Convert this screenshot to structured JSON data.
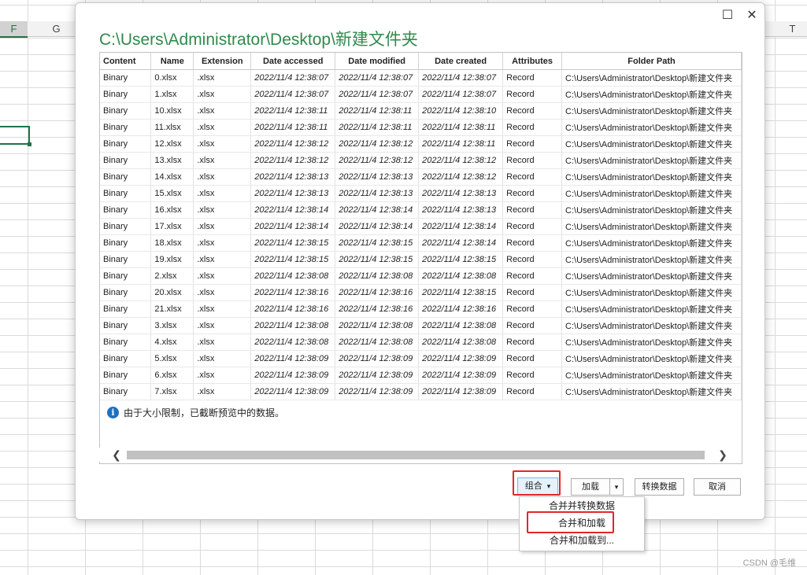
{
  "spreadsheet": {
    "col_headers": [
      {
        "label": "F",
        "selected": true
      },
      {
        "label": "G",
        "selected": false
      },
      {
        "label": "T",
        "selected": false
      }
    ],
    "watermark": "CSDN @毛维"
  },
  "dialog": {
    "title": "C:\\Users\\Administrator\\Desktop\\新建文件夹",
    "window_buttons": {
      "maximize": "☐",
      "close": "✕"
    },
    "table": {
      "columns": [
        "Content",
        "Name",
        "Extension",
        "Date accessed",
        "Date modified",
        "Date created",
        "Attributes",
        "Folder Path"
      ],
      "rows": [
        [
          "Binary",
          "0.xlsx",
          ".xlsx",
          "2022/11/4 12:38:07",
          "2022/11/4 12:38:07",
          "2022/11/4 12:38:07",
          "Record",
          "C:\\Users\\Administrator\\Desktop\\新建文件夹"
        ],
        [
          "Binary",
          "1.xlsx",
          ".xlsx",
          "2022/11/4 12:38:07",
          "2022/11/4 12:38:07",
          "2022/11/4 12:38:07",
          "Record",
          "C:\\Users\\Administrator\\Desktop\\新建文件夹"
        ],
        [
          "Binary",
          "10.xlsx",
          ".xlsx",
          "2022/11/4 12:38:11",
          "2022/11/4 12:38:11",
          "2022/11/4 12:38:10",
          "Record",
          "C:\\Users\\Administrator\\Desktop\\新建文件夹"
        ],
        [
          "Binary",
          "11.xlsx",
          ".xlsx",
          "2022/11/4 12:38:11",
          "2022/11/4 12:38:11",
          "2022/11/4 12:38:11",
          "Record",
          "C:\\Users\\Administrator\\Desktop\\新建文件夹"
        ],
        [
          "Binary",
          "12.xlsx",
          ".xlsx",
          "2022/11/4 12:38:12",
          "2022/11/4 12:38:12",
          "2022/11/4 12:38:11",
          "Record",
          "C:\\Users\\Administrator\\Desktop\\新建文件夹"
        ],
        [
          "Binary",
          "13.xlsx",
          ".xlsx",
          "2022/11/4 12:38:12",
          "2022/11/4 12:38:12",
          "2022/11/4 12:38:12",
          "Record",
          "C:\\Users\\Administrator\\Desktop\\新建文件夹"
        ],
        [
          "Binary",
          "14.xlsx",
          ".xlsx",
          "2022/11/4 12:38:13",
          "2022/11/4 12:38:13",
          "2022/11/4 12:38:12",
          "Record",
          "C:\\Users\\Administrator\\Desktop\\新建文件夹"
        ],
        [
          "Binary",
          "15.xlsx",
          ".xlsx",
          "2022/11/4 12:38:13",
          "2022/11/4 12:38:13",
          "2022/11/4 12:38:13",
          "Record",
          "C:\\Users\\Administrator\\Desktop\\新建文件夹"
        ],
        [
          "Binary",
          "16.xlsx",
          ".xlsx",
          "2022/11/4 12:38:14",
          "2022/11/4 12:38:14",
          "2022/11/4 12:38:13",
          "Record",
          "C:\\Users\\Administrator\\Desktop\\新建文件夹"
        ],
        [
          "Binary",
          "17.xlsx",
          ".xlsx",
          "2022/11/4 12:38:14",
          "2022/11/4 12:38:14",
          "2022/11/4 12:38:14",
          "Record",
          "C:\\Users\\Administrator\\Desktop\\新建文件夹"
        ],
        [
          "Binary",
          "18.xlsx",
          ".xlsx",
          "2022/11/4 12:38:15",
          "2022/11/4 12:38:15",
          "2022/11/4 12:38:14",
          "Record",
          "C:\\Users\\Administrator\\Desktop\\新建文件夹"
        ],
        [
          "Binary",
          "19.xlsx",
          ".xlsx",
          "2022/11/4 12:38:15",
          "2022/11/4 12:38:15",
          "2022/11/4 12:38:15",
          "Record",
          "C:\\Users\\Administrator\\Desktop\\新建文件夹"
        ],
        [
          "Binary",
          "2.xlsx",
          ".xlsx",
          "2022/11/4 12:38:08",
          "2022/11/4 12:38:08",
          "2022/11/4 12:38:08",
          "Record",
          "C:\\Users\\Administrator\\Desktop\\新建文件夹"
        ],
        [
          "Binary",
          "20.xlsx",
          ".xlsx",
          "2022/11/4 12:38:16",
          "2022/11/4 12:38:16",
          "2022/11/4 12:38:15",
          "Record",
          "C:\\Users\\Administrator\\Desktop\\新建文件夹"
        ],
        [
          "Binary",
          "21.xlsx",
          ".xlsx",
          "2022/11/4 12:38:16",
          "2022/11/4 12:38:16",
          "2022/11/4 12:38:16",
          "Record",
          "C:\\Users\\Administrator\\Desktop\\新建文件夹"
        ],
        [
          "Binary",
          "3.xlsx",
          ".xlsx",
          "2022/11/4 12:38:08",
          "2022/11/4 12:38:08",
          "2022/11/4 12:38:08",
          "Record",
          "C:\\Users\\Administrator\\Desktop\\新建文件夹"
        ],
        [
          "Binary",
          "4.xlsx",
          ".xlsx",
          "2022/11/4 12:38:08",
          "2022/11/4 12:38:08",
          "2022/11/4 12:38:08",
          "Record",
          "C:\\Users\\Administrator\\Desktop\\新建文件夹"
        ],
        [
          "Binary",
          "5.xlsx",
          ".xlsx",
          "2022/11/4 12:38:09",
          "2022/11/4 12:38:09",
          "2022/11/4 12:38:09",
          "Record",
          "C:\\Users\\Administrator\\Desktop\\新建文件夹"
        ],
        [
          "Binary",
          "6.xlsx",
          ".xlsx",
          "2022/11/4 12:38:09",
          "2022/11/4 12:38:09",
          "2022/11/4 12:38:09",
          "Record",
          "C:\\Users\\Administrator\\Desktop\\新建文件夹"
        ],
        [
          "Binary",
          "7.xlsx",
          ".xlsx",
          "2022/11/4 12:38:09",
          "2022/11/4 12:38:09",
          "2022/11/4 12:38:09",
          "Record",
          "C:\\Users\\Administrator\\Desktop\\新建文件夹"
        ]
      ]
    },
    "info_message": "由于大小限制，已截断预览中的数据。",
    "scroll_arrows": {
      "left": "❮",
      "right": "❯"
    },
    "buttons": {
      "combine": "组合",
      "combine_arrow": "▾",
      "load": "加载",
      "load_arrow": "▾",
      "transform": "转换数据",
      "cancel": "取消"
    },
    "combine_menu": [
      "合并并转换数据",
      "合并和加载",
      "合并和加载到..."
    ]
  },
  "colors": {
    "title_green": "#2f8a4c",
    "highlight_red": "#e0262b",
    "excel_green": "#217346"
  }
}
